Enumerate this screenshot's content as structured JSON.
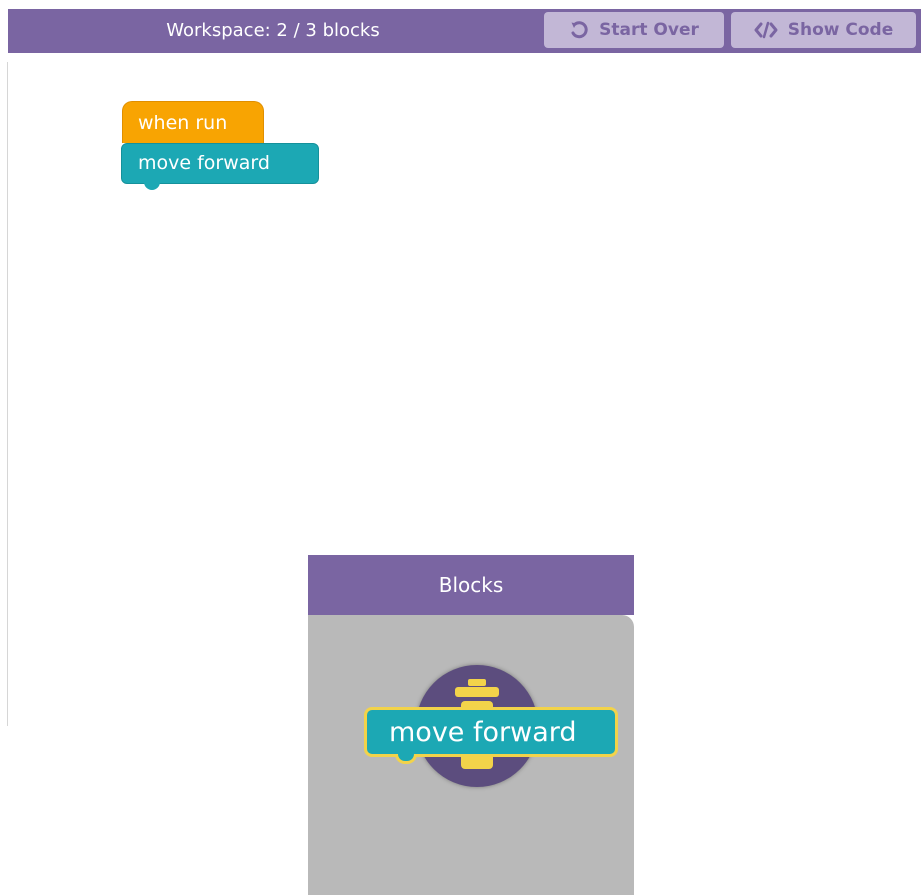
{
  "header": {
    "workspace_label": "Workspace: 2 / 3 blocks",
    "start_over_label": "Start Over",
    "show_code_label": "Show Code",
    "start_over_icon": "undo-icon",
    "show_code_icon": "code-icon"
  },
  "workspace": {
    "blocks": [
      {
        "label": "when run",
        "kind": "event",
        "color": "#f8a402"
      },
      {
        "label": "move forward",
        "kind": "action",
        "color": "#1ca8b4"
      }
    ]
  },
  "toolbox": {
    "title": "Blocks",
    "trash_icon": "trash-icon",
    "dragging_block": {
      "label": "move forward",
      "color": "#1ca8b4",
      "highlight": "#f2d34a"
    }
  },
  "colors": {
    "header_bg": "#7a65a2",
    "button_bg": "#c2b7d6",
    "toolbox_bg": "#b9b9b9"
  }
}
